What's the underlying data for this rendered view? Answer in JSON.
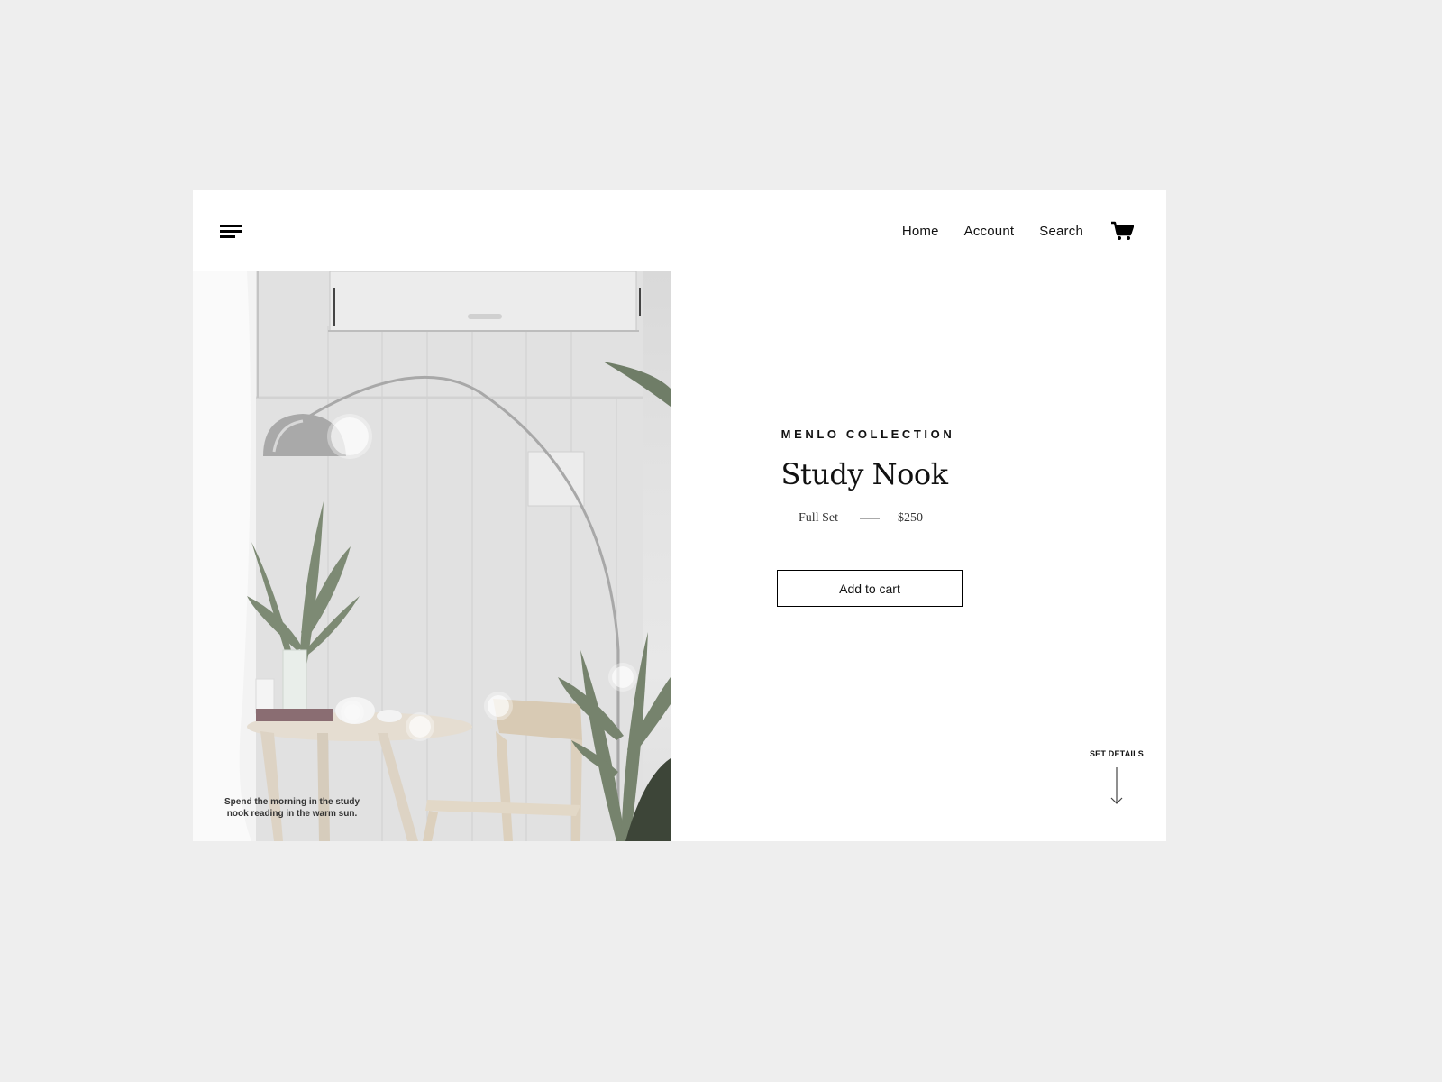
{
  "header": {
    "menu_icon": "hamburger-menu-icon",
    "nav": [
      {
        "label": "Home"
      },
      {
        "label": "Account"
      },
      {
        "label": "Search"
      }
    ],
    "cart_icon": "shopping-cart-icon"
  },
  "hero": {
    "caption": "Spend the morning in the study nook reading in the warm sun.",
    "hotspot_count": 5
  },
  "product": {
    "collection": "MENLO COLLECTION",
    "title": "Study Nook",
    "variant": "Full Set",
    "price": "$250",
    "add_to_cart_label": "Add to cart"
  },
  "footer_link": {
    "label": "SET DETAILS",
    "icon": "arrow-down-icon"
  },
  "colors": {
    "page_background": "#eeeeee",
    "card_background": "#ffffff",
    "text": "#111111",
    "plant_green": "#7d8a74"
  }
}
